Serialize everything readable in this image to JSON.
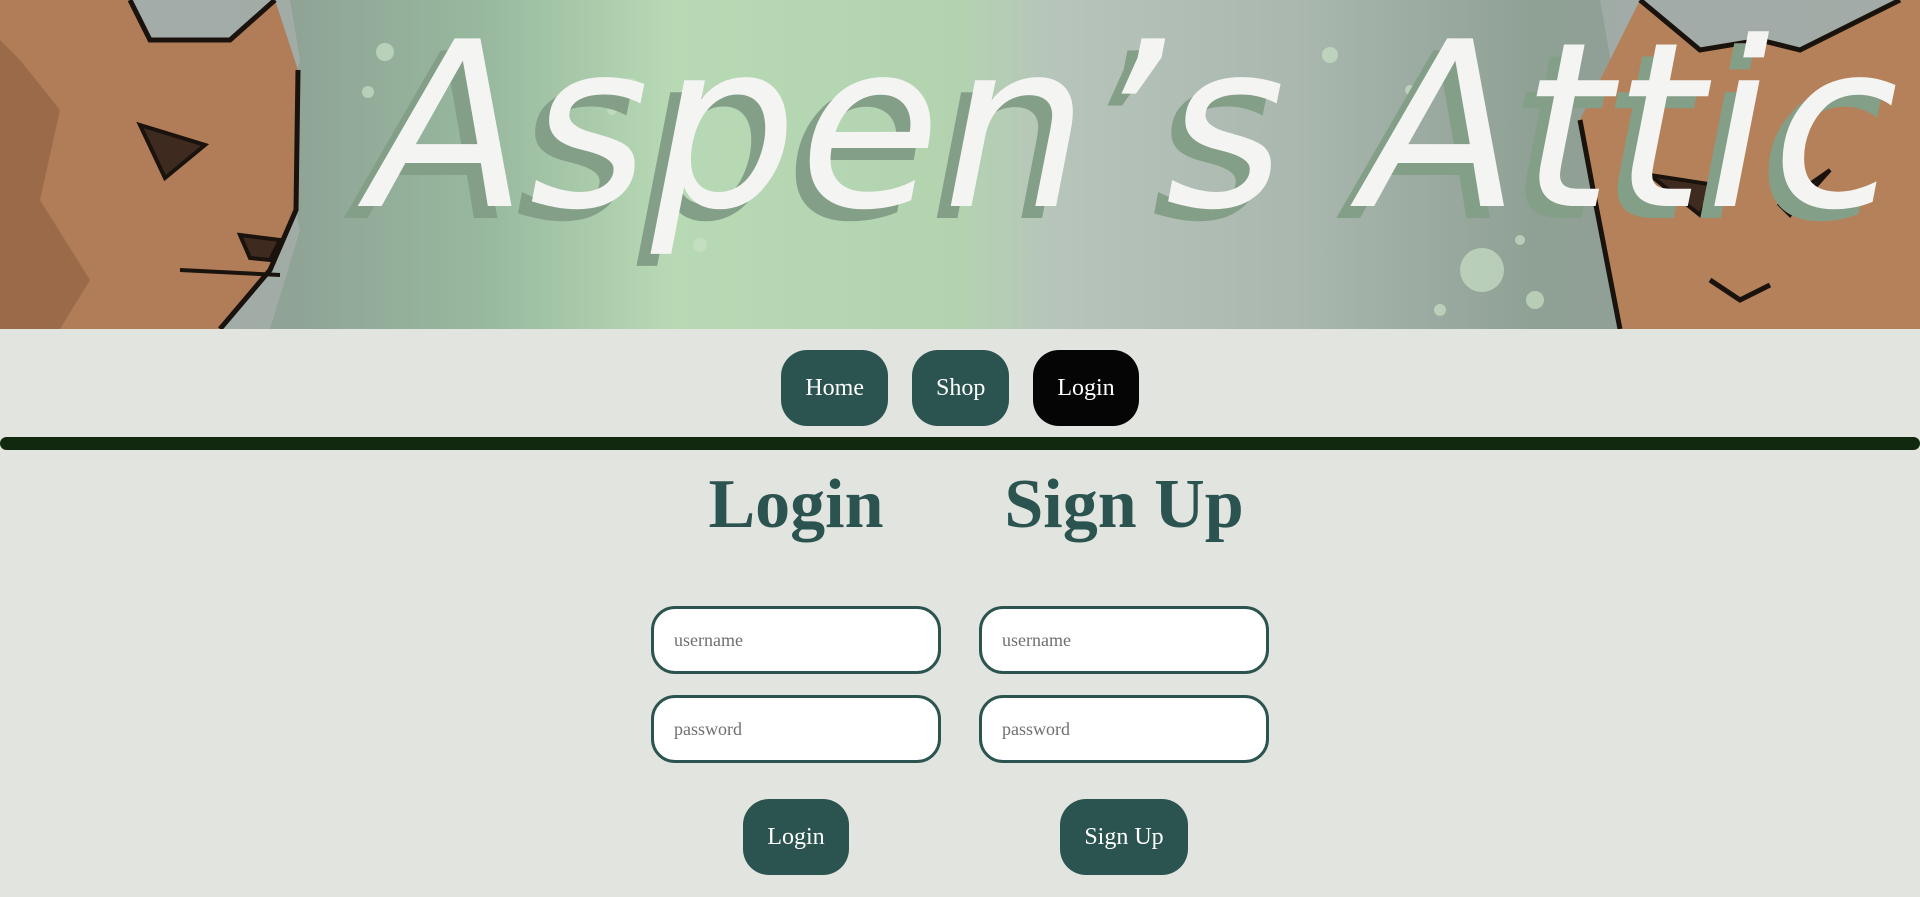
{
  "banner": {
    "title": "Aspen’s Attic"
  },
  "nav": {
    "items": [
      {
        "label": "Home"
      },
      {
        "label": "Shop"
      },
      {
        "label": "Login",
        "active": true
      }
    ]
  },
  "login": {
    "heading": "Login",
    "username_placeholder": "username",
    "password_placeholder": "password",
    "button_label": "Login"
  },
  "signup": {
    "heading": "Sign Up",
    "username_placeholder": "username",
    "password_placeholder": "password",
    "button_label": "Sign Up"
  },
  "colors": {
    "primary": "#2b5450",
    "active_nav": "#050505",
    "divider": "#10290f",
    "background": "#e2e4e0"
  }
}
